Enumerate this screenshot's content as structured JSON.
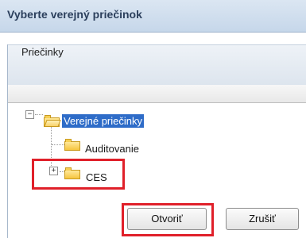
{
  "dialog": {
    "title": "Vyberte verejný priečinok"
  },
  "tree": {
    "header": "Priečinky",
    "root": {
      "label": "Verejné priečinky",
      "expander": "−",
      "selected": true
    },
    "children": [
      {
        "label": "Auditovanie"
      },
      {
        "label": "CES",
        "expander": "+"
      }
    ]
  },
  "buttons": {
    "open_label": "Otvoriť",
    "cancel_label": "Zrušiť"
  },
  "colors": {
    "selection": "#2e6cc8",
    "highlight": "#e0202a"
  }
}
